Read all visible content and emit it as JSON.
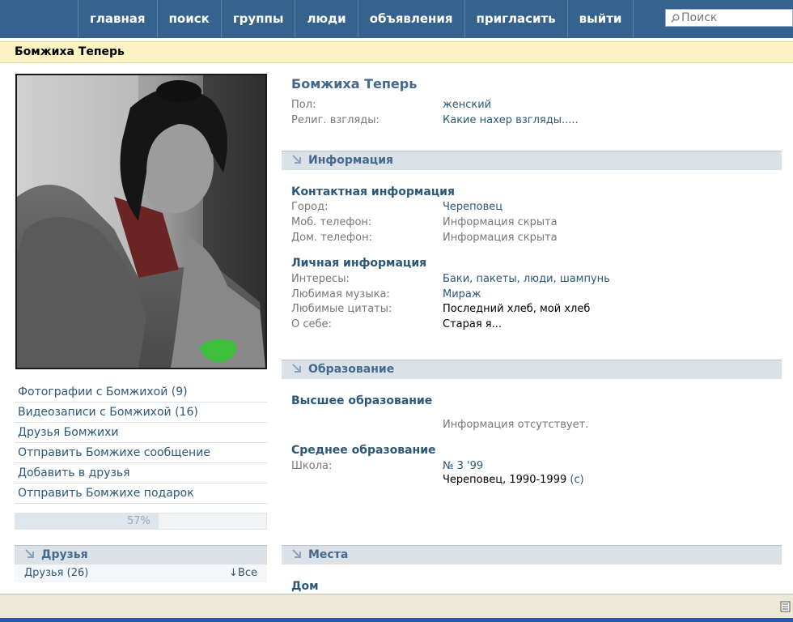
{
  "nav": {
    "items": [
      "главная",
      "поиск",
      "группы",
      "люди",
      "объявления",
      "пригласить",
      "выйти"
    ],
    "search_placeholder": "Поиск"
  },
  "page_name": "Бомжиха Теперь",
  "left": {
    "menu": [
      "Фотографии с Бомжихой (9)",
      "Видеозаписи с Бомжихой (16)",
      "Друзья Бомжихи",
      "Отправить Бомжихе сообщение",
      "Добавить в друзья",
      "Отправить Бомжихе подарок"
    ],
    "rating": {
      "value": 57,
      "label": "57%"
    },
    "friends": {
      "header": "Друзья",
      "count_label": "Друзья (26)",
      "all_label": "↓Все"
    }
  },
  "profile": {
    "name": "Бомжиха Теперь",
    "basic": [
      {
        "label": "Пол:",
        "value": "женский",
        "style": "link"
      },
      {
        "label": "Религ. взгляды:",
        "value": "Какие нахер взгляды.....",
        "style": "link"
      }
    ]
  },
  "info": {
    "header": "Информация",
    "contact": {
      "title": "Контактная информация",
      "rows": [
        {
          "label": "Город:",
          "value": "Череповец",
          "style": "link"
        },
        {
          "label": "Моб. телефон:",
          "value": "Информация скрыта",
          "style": "gray"
        },
        {
          "label": "Дом. телефон:",
          "value": "Информация скрыта",
          "style": "gray"
        }
      ]
    },
    "personal": {
      "title": "Личная информация",
      "rows": [
        {
          "label": "Интересы:",
          "value": "Баки, пакеты, люди, шампунь",
          "style": "link"
        },
        {
          "label": "Любимая музыка:",
          "value": "Мираж",
          "style": "link"
        },
        {
          "label": "Любимые цитаты:",
          "value": "Последний хлеб, мой хлеб",
          "style": "plain"
        },
        {
          "label": "О себе:",
          "value": "Старая я...",
          "style": "plain"
        }
      ]
    }
  },
  "education": {
    "header": "Образование",
    "higher": {
      "title": "Высшее образование",
      "note": "Информация отсутствует."
    },
    "secondary": {
      "title": "Среднее образование",
      "school_label": "Школа:",
      "school_value": "№ 3 '99",
      "school_details": "Череповец, 1990-1999",
      "school_class": "(с)"
    }
  },
  "places": {
    "header": "Места",
    "home": "Дом"
  },
  "colors": {
    "nav_bg": "#36638e",
    "link": "#2b587a",
    "header_bg": "#dae2e8",
    "name_strip": "#fbf3c4"
  }
}
